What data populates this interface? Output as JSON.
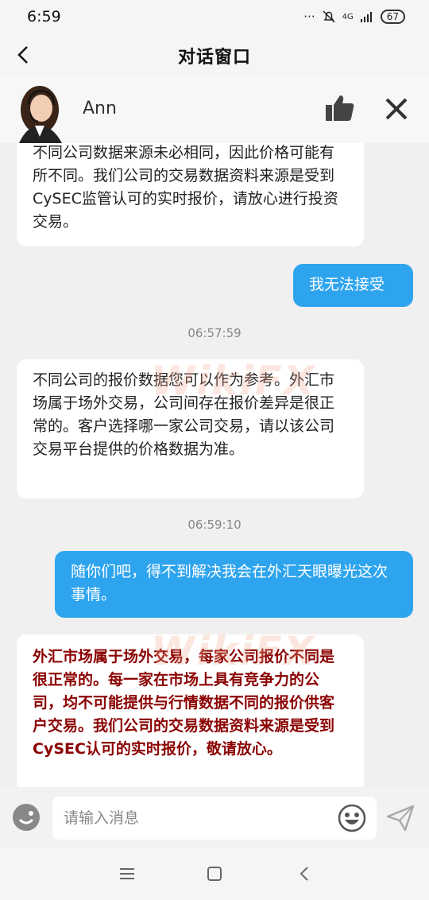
{
  "status_bar": {
    "time": "6:59",
    "network": "4G",
    "battery": "67"
  },
  "header": {
    "title": "对话窗口"
  },
  "agent": {
    "name": "Ann"
  },
  "watermark": "WikiFX",
  "messages": [
    {
      "type": "incoming",
      "text": "不同公司数据来源未必相同，因此价格可能有所不同。我们公司的交易数据资料来源是受到CySEC监管认可的实时报价，请放心进行投资交易。"
    },
    {
      "type": "outgoing",
      "text": "我无法接受"
    },
    {
      "type": "timestamp",
      "text": "06:57:59"
    },
    {
      "type": "incoming",
      "text": "不同公司的报价数据您可以作为参考。外汇市场属于场外交易，公司间存在报价差异是很正常的。客户选择哪一家公司交易，请以该公司交易平台提供的价格数据为准。"
    },
    {
      "type": "timestamp",
      "text": "06:59:10"
    },
    {
      "type": "outgoing",
      "text": "随你们吧，得不到解决我会在外汇天眼曝光这次事情。"
    },
    {
      "type": "incoming-highlight",
      "text": "外汇市场属于场外交易，每家公司报价不同是很正常的。每一家在市场上具有竞争力的公司，均不可能提供与行情数据不同的报价供客户交易。我们公司的交易数据资料来源是受到CySEC认可的实时报价，敬请放心。"
    }
  ],
  "input": {
    "placeholder": "请输入消息"
  },
  "colors": {
    "outgoing_bubble": "#2ea4ee",
    "highlight_text": "#8b0000"
  }
}
